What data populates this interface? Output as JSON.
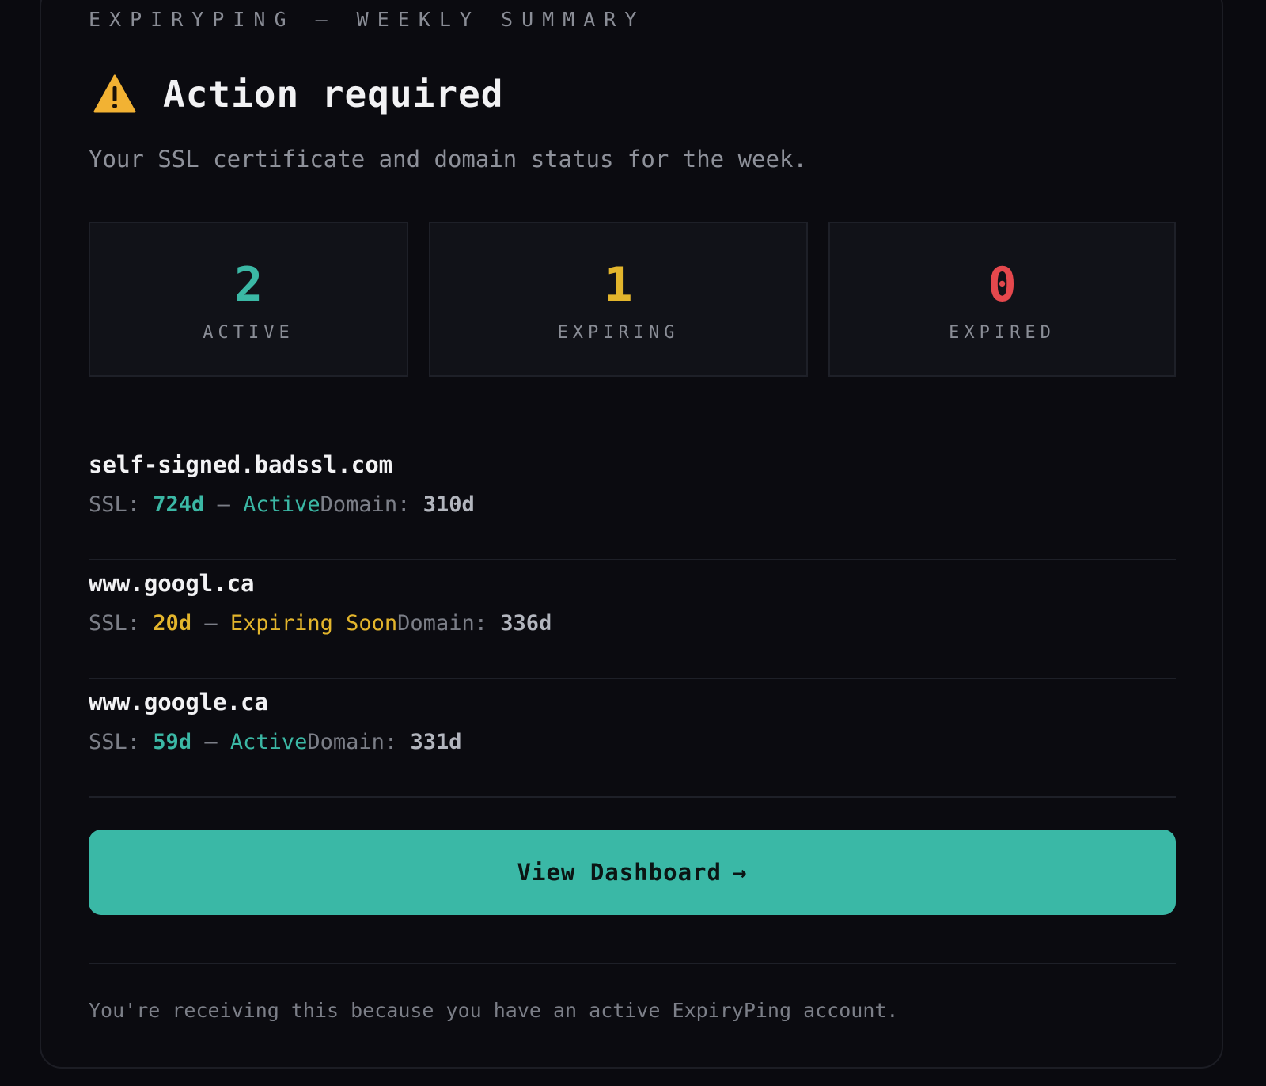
{
  "header": {
    "eyebrow": "EXPIRYPING — WEEKLY SUMMARY",
    "title": "Action required",
    "icon": "warning-icon",
    "subtitle": "Your SSL certificate and domain status for the week."
  },
  "stats": [
    {
      "value": "2",
      "label": "ACTIVE",
      "color": "#3bb8a5"
    },
    {
      "value": "1",
      "label": "EXPIRING",
      "color": "#e3b52c"
    },
    {
      "value": "0",
      "label": "EXPIRED",
      "color": "#e5484d"
    }
  ],
  "colors": {
    "active": "#3bb8a5",
    "expiring": "#e3b52c",
    "expired": "#e5484d",
    "accent": "#3ab8a6"
  },
  "domains": [
    {
      "name": "self-signed.badssl.com",
      "ssl_prefix": "SSL: ",
      "ssl_days": "724d",
      "separator": " — ",
      "ssl_status": "Active",
      "domain_prefix": "Domain: ",
      "domain_days": "310d",
      "status_color": "#3bb8a5"
    },
    {
      "name": "www.googl.ca",
      "ssl_prefix": "SSL: ",
      "ssl_days": "20d",
      "separator": " — ",
      "ssl_status": "Expiring Soon",
      "domain_prefix": "Domain: ",
      "domain_days": "336d",
      "status_color": "#e3b52c"
    },
    {
      "name": "www.google.ca",
      "ssl_prefix": "SSL: ",
      "ssl_days": "59d",
      "separator": " — ",
      "ssl_status": "Active",
      "domain_prefix": "Domain: ",
      "domain_days": "331d",
      "status_color": "#3bb8a5"
    }
  ],
  "cta": {
    "label": "View Dashboard",
    "arrow": "→"
  },
  "footer": {
    "text": "You're receiving this because you have an active ExpiryPing account."
  }
}
